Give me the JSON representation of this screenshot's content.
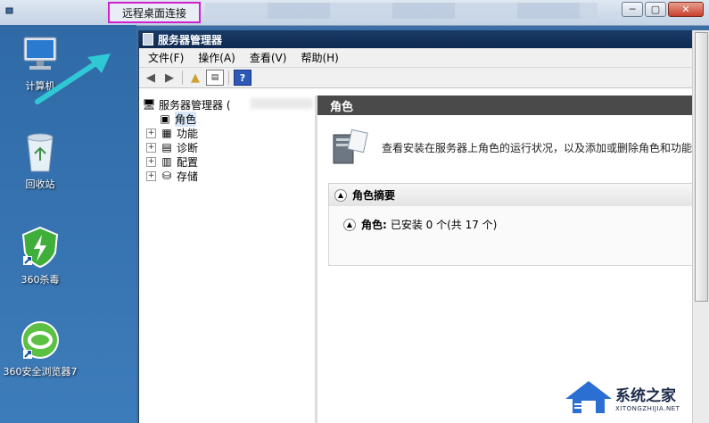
{
  "rdp": {
    "title": "远程桌面连接",
    "controls": {
      "minimize": "─",
      "restore": "▢",
      "close": "✕"
    }
  },
  "desktop": {
    "icons": [
      {
        "label": "计算机",
        "icon": "computer-icon"
      },
      {
        "label": "回收站",
        "icon": "recycle-bin-icon"
      },
      {
        "label": "360杀毒",
        "icon": "360-antivirus-icon"
      },
      {
        "label": "360安全浏览器7",
        "icon": "360-browser-icon"
      }
    ]
  },
  "mmc": {
    "title": "服务器管理器",
    "menu": [
      "文件(F)",
      "操作(A)",
      "查看(V)",
      "帮助(H)"
    ],
    "toolbar": {
      "help": "?"
    },
    "tree": {
      "root": "服务器管理器 (",
      "items": [
        {
          "label": "角色",
          "expandable": false,
          "selected": true
        },
        {
          "label": "功能",
          "expandable": true
        },
        {
          "label": "诊断",
          "expandable": true
        },
        {
          "label": "配置",
          "expandable": true
        },
        {
          "label": "存储",
          "expandable": true
        }
      ]
    },
    "content": {
      "header": "角色",
      "intro": "查看安装在服务器上角色的运行状况，以及添加或删除角色和功能",
      "summary_title": "角色摘要",
      "roles_label": "角色:",
      "roles_value": "已安装 0 个(共 17 个)"
    }
  },
  "watermark": {
    "main": "系统之家",
    "sub": "XITONGZHIJIA.NET"
  },
  "colors": {
    "highlight_border": "#d21fd2",
    "arrow": "#2fc9d6",
    "mmc_title": "#0f2a50",
    "content_header": "#4a4a4a"
  }
}
